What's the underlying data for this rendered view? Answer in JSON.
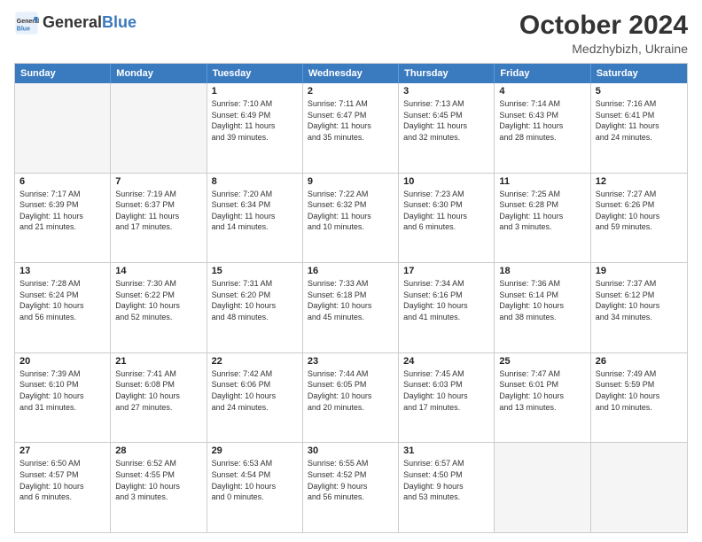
{
  "header": {
    "logo_line1": "General",
    "logo_line2": "Blue",
    "month": "October 2024",
    "location": "Medzhybizh, Ukraine"
  },
  "weekdays": [
    "Sunday",
    "Monday",
    "Tuesday",
    "Wednesday",
    "Thursday",
    "Friday",
    "Saturday"
  ],
  "rows": [
    [
      {
        "day": "",
        "empty": true
      },
      {
        "day": "",
        "empty": true
      },
      {
        "day": "1",
        "line1": "Sunrise: 7:10 AM",
        "line2": "Sunset: 6:49 PM",
        "line3": "Daylight: 11 hours",
        "line4": "and 39 minutes."
      },
      {
        "day": "2",
        "line1": "Sunrise: 7:11 AM",
        "line2": "Sunset: 6:47 PM",
        "line3": "Daylight: 11 hours",
        "line4": "and 35 minutes."
      },
      {
        "day": "3",
        "line1": "Sunrise: 7:13 AM",
        "line2": "Sunset: 6:45 PM",
        "line3": "Daylight: 11 hours",
        "line4": "and 32 minutes."
      },
      {
        "day": "4",
        "line1": "Sunrise: 7:14 AM",
        "line2": "Sunset: 6:43 PM",
        "line3": "Daylight: 11 hours",
        "line4": "and 28 minutes."
      },
      {
        "day": "5",
        "line1": "Sunrise: 7:16 AM",
        "line2": "Sunset: 6:41 PM",
        "line3": "Daylight: 11 hours",
        "line4": "and 24 minutes."
      }
    ],
    [
      {
        "day": "6",
        "line1": "Sunrise: 7:17 AM",
        "line2": "Sunset: 6:39 PM",
        "line3": "Daylight: 11 hours",
        "line4": "and 21 minutes."
      },
      {
        "day": "7",
        "line1": "Sunrise: 7:19 AM",
        "line2": "Sunset: 6:37 PM",
        "line3": "Daylight: 11 hours",
        "line4": "and 17 minutes."
      },
      {
        "day": "8",
        "line1": "Sunrise: 7:20 AM",
        "line2": "Sunset: 6:34 PM",
        "line3": "Daylight: 11 hours",
        "line4": "and 14 minutes."
      },
      {
        "day": "9",
        "line1": "Sunrise: 7:22 AM",
        "line2": "Sunset: 6:32 PM",
        "line3": "Daylight: 11 hours",
        "line4": "and 10 minutes."
      },
      {
        "day": "10",
        "line1": "Sunrise: 7:23 AM",
        "line2": "Sunset: 6:30 PM",
        "line3": "Daylight: 11 hours",
        "line4": "and 6 minutes."
      },
      {
        "day": "11",
        "line1": "Sunrise: 7:25 AM",
        "line2": "Sunset: 6:28 PM",
        "line3": "Daylight: 11 hours",
        "line4": "and 3 minutes."
      },
      {
        "day": "12",
        "line1": "Sunrise: 7:27 AM",
        "line2": "Sunset: 6:26 PM",
        "line3": "Daylight: 10 hours",
        "line4": "and 59 minutes."
      }
    ],
    [
      {
        "day": "13",
        "line1": "Sunrise: 7:28 AM",
        "line2": "Sunset: 6:24 PM",
        "line3": "Daylight: 10 hours",
        "line4": "and 56 minutes."
      },
      {
        "day": "14",
        "line1": "Sunrise: 7:30 AM",
        "line2": "Sunset: 6:22 PM",
        "line3": "Daylight: 10 hours",
        "line4": "and 52 minutes."
      },
      {
        "day": "15",
        "line1": "Sunrise: 7:31 AM",
        "line2": "Sunset: 6:20 PM",
        "line3": "Daylight: 10 hours",
        "line4": "and 48 minutes."
      },
      {
        "day": "16",
        "line1": "Sunrise: 7:33 AM",
        "line2": "Sunset: 6:18 PM",
        "line3": "Daylight: 10 hours",
        "line4": "and 45 minutes."
      },
      {
        "day": "17",
        "line1": "Sunrise: 7:34 AM",
        "line2": "Sunset: 6:16 PM",
        "line3": "Daylight: 10 hours",
        "line4": "and 41 minutes."
      },
      {
        "day": "18",
        "line1": "Sunrise: 7:36 AM",
        "line2": "Sunset: 6:14 PM",
        "line3": "Daylight: 10 hours",
        "line4": "and 38 minutes."
      },
      {
        "day": "19",
        "line1": "Sunrise: 7:37 AM",
        "line2": "Sunset: 6:12 PM",
        "line3": "Daylight: 10 hours",
        "line4": "and 34 minutes."
      }
    ],
    [
      {
        "day": "20",
        "line1": "Sunrise: 7:39 AM",
        "line2": "Sunset: 6:10 PM",
        "line3": "Daylight: 10 hours",
        "line4": "and 31 minutes."
      },
      {
        "day": "21",
        "line1": "Sunrise: 7:41 AM",
        "line2": "Sunset: 6:08 PM",
        "line3": "Daylight: 10 hours",
        "line4": "and 27 minutes."
      },
      {
        "day": "22",
        "line1": "Sunrise: 7:42 AM",
        "line2": "Sunset: 6:06 PM",
        "line3": "Daylight: 10 hours",
        "line4": "and 24 minutes."
      },
      {
        "day": "23",
        "line1": "Sunrise: 7:44 AM",
        "line2": "Sunset: 6:05 PM",
        "line3": "Daylight: 10 hours",
        "line4": "and 20 minutes."
      },
      {
        "day": "24",
        "line1": "Sunrise: 7:45 AM",
        "line2": "Sunset: 6:03 PM",
        "line3": "Daylight: 10 hours",
        "line4": "and 17 minutes."
      },
      {
        "day": "25",
        "line1": "Sunrise: 7:47 AM",
        "line2": "Sunset: 6:01 PM",
        "line3": "Daylight: 10 hours",
        "line4": "and 13 minutes."
      },
      {
        "day": "26",
        "line1": "Sunrise: 7:49 AM",
        "line2": "Sunset: 5:59 PM",
        "line3": "Daylight: 10 hours",
        "line4": "and 10 minutes."
      }
    ],
    [
      {
        "day": "27",
        "line1": "Sunrise: 6:50 AM",
        "line2": "Sunset: 4:57 PM",
        "line3": "Daylight: 10 hours",
        "line4": "and 6 minutes."
      },
      {
        "day": "28",
        "line1": "Sunrise: 6:52 AM",
        "line2": "Sunset: 4:55 PM",
        "line3": "Daylight: 10 hours",
        "line4": "and 3 minutes."
      },
      {
        "day": "29",
        "line1": "Sunrise: 6:53 AM",
        "line2": "Sunset: 4:54 PM",
        "line3": "Daylight: 10 hours",
        "line4": "and 0 minutes."
      },
      {
        "day": "30",
        "line1": "Sunrise: 6:55 AM",
        "line2": "Sunset: 4:52 PM",
        "line3": "Daylight: 9 hours",
        "line4": "and 56 minutes."
      },
      {
        "day": "31",
        "line1": "Sunrise: 6:57 AM",
        "line2": "Sunset: 4:50 PM",
        "line3": "Daylight: 9 hours",
        "line4": "and 53 minutes."
      },
      {
        "day": "",
        "empty": true
      },
      {
        "day": "",
        "empty": true
      }
    ]
  ]
}
